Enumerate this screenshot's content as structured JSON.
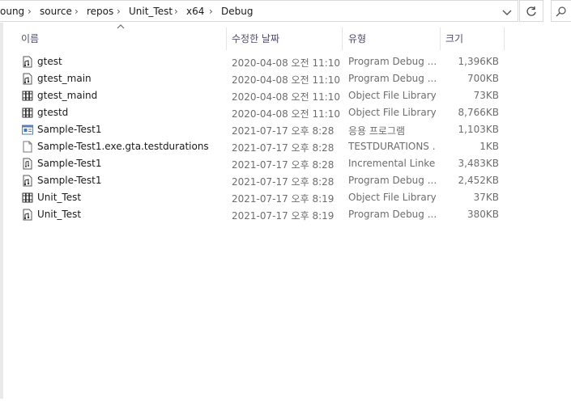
{
  "address": {
    "crumbs": [
      "oung",
      "source",
      "repos",
      "Unit_Test",
      "x64",
      "Debug"
    ],
    "separator": "›"
  },
  "columns": {
    "name": "이름",
    "date": "수정한 날짜",
    "type": "유형",
    "size": "크기"
  },
  "files": [
    {
      "name": "gtest",
      "date": "2020-04-08 오전 11:10",
      "type": "Program Debug ...",
      "size": "1,396KB",
      "icon": "pdb-file-icon"
    },
    {
      "name": "gtest_main",
      "date": "2020-04-08 오전 11:10",
      "type": "Program Debug ...",
      "size": "700KB",
      "icon": "pdb-file-icon"
    },
    {
      "name": "gtest_maind",
      "date": "2020-04-08 오전 11:10",
      "type": "Object File Library",
      "size": "73KB",
      "icon": "library-file-icon"
    },
    {
      "name": "gtestd",
      "date": "2020-04-08 오전 11:10",
      "type": "Object File Library",
      "size": "8,766KB",
      "icon": "library-file-icon"
    },
    {
      "name": "Sample-Test1",
      "date": "2021-07-17 오후 8:28",
      "type": "응용 프로그램",
      "size": "1,103KB",
      "icon": "application-icon"
    },
    {
      "name": "Sample-Test1.exe.gta.testdurations",
      "date": "2021-07-17 오후 8:28",
      "type": "TESTDURATIONS ...",
      "size": "1KB",
      "icon": "blank-file-icon"
    },
    {
      "name": "Sample-Test1",
      "date": "2021-07-17 오후 8:28",
      "type": "Incremental Linke...",
      "size": "3,483KB",
      "icon": "ilk-file-icon"
    },
    {
      "name": "Sample-Test1",
      "date": "2021-07-17 오후 8:28",
      "type": "Program Debug ...",
      "size": "2,452KB",
      "icon": "pdb-file-icon"
    },
    {
      "name": "Unit_Test",
      "date": "2021-07-17 오후 8:19",
      "type": "Object File Library",
      "size": "37KB",
      "icon": "library-file-icon"
    },
    {
      "name": "Unit_Test",
      "date": "2021-07-17 오후 8:19",
      "type": "Program Debug ...",
      "size": "380KB",
      "icon": "pdb-file-icon"
    }
  ]
}
